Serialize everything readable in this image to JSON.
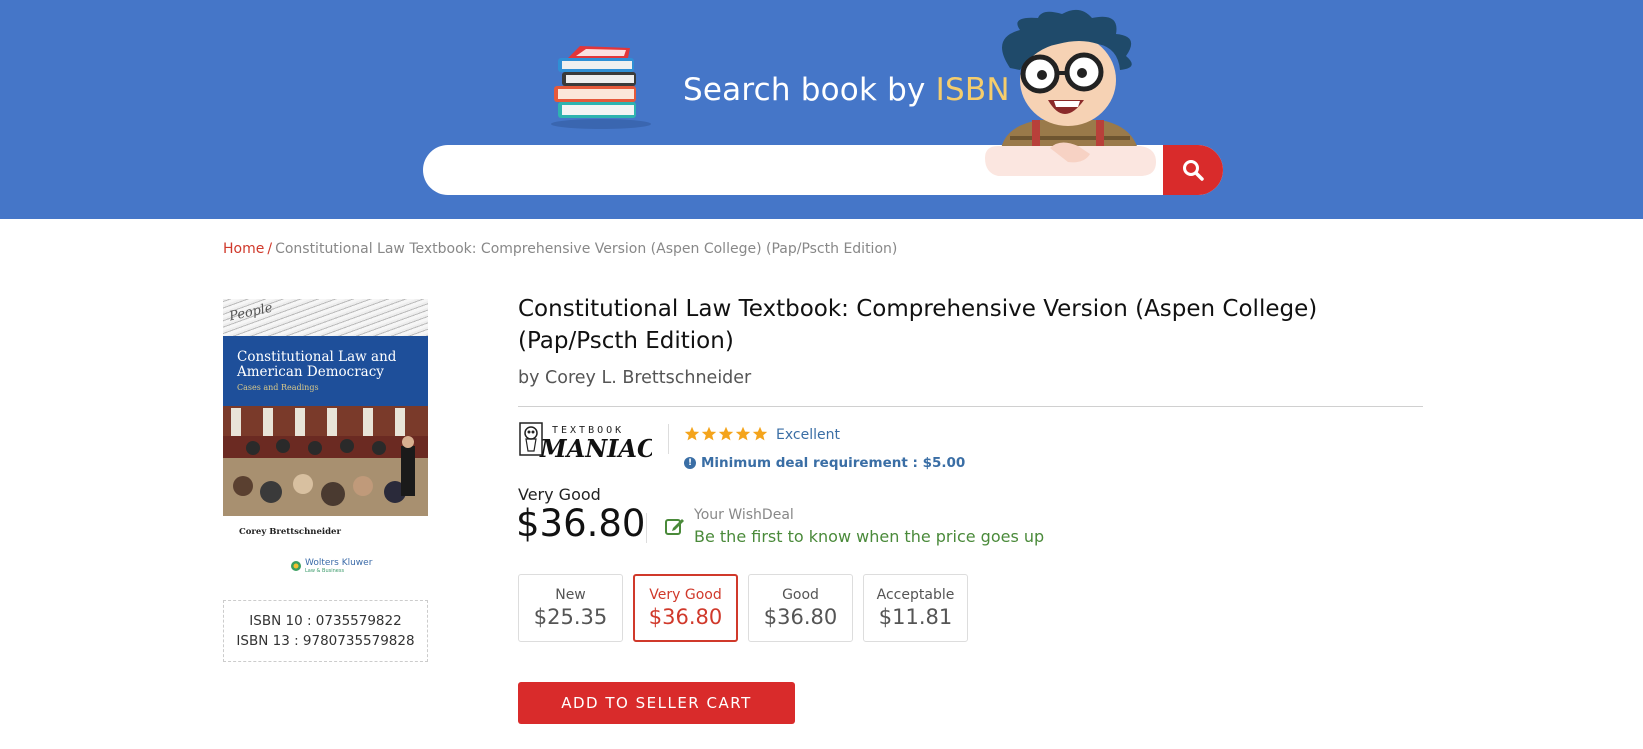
{
  "header": {
    "title_prefix": "Search book by ",
    "title_accent": "ISBN",
    "search_placeholder": "",
    "search_value": ""
  },
  "breadcrumb": {
    "home": "Home",
    "separator": "/",
    "current": "Constitutional Law Textbook: Comprehensive Version (Aspen College) (Pap/Pscth Edition)"
  },
  "cover": {
    "title": "Constitutional Law and American Democracy",
    "subtitle": "Cases and Readings",
    "author": "Corey Brettschneider",
    "publisher": "Wolters Kluwer",
    "publisher_sub": "Law & Business",
    "manuscript_text": "People"
  },
  "isbn": {
    "isbn10": "ISBN 10 : 0735579822",
    "isbn13": "ISBN 13 : 9780735579828"
  },
  "product": {
    "title": "Constitutional Law Textbook: Comprehensive Version (Aspen College) (Pap/Pscth Edition)",
    "author": "by Corey L. Brettschneider"
  },
  "seller": {
    "logo_line1": "TEXTBOOK",
    "logo_line2": "MANIAC",
    "rating_stars": 5,
    "rating_label": "Excellent",
    "min_deal": "Minimum deal requirement : $5.00"
  },
  "offer": {
    "condition": "Very Good",
    "price": "$36.80",
    "wish_label": "Your WishDeal",
    "wish_cta": "Be the first to know when the price goes up"
  },
  "conditions": [
    {
      "label": "New",
      "price": "$25.35",
      "selected": false
    },
    {
      "label": "Very Good",
      "price": "$36.80",
      "selected": true
    },
    {
      "label": "Good",
      "price": "$36.80",
      "selected": false
    },
    {
      "label": "Acceptable",
      "price": "$11.81",
      "selected": false
    }
  ],
  "cart_button": "ADD TO SELLER CART",
  "colors": {
    "header_bg": "#4576c8",
    "accent": "#f5cd6c",
    "brand_red": "#d92b2b",
    "link_blue": "#3a6ea5",
    "wish_green": "#4a8a3a"
  }
}
